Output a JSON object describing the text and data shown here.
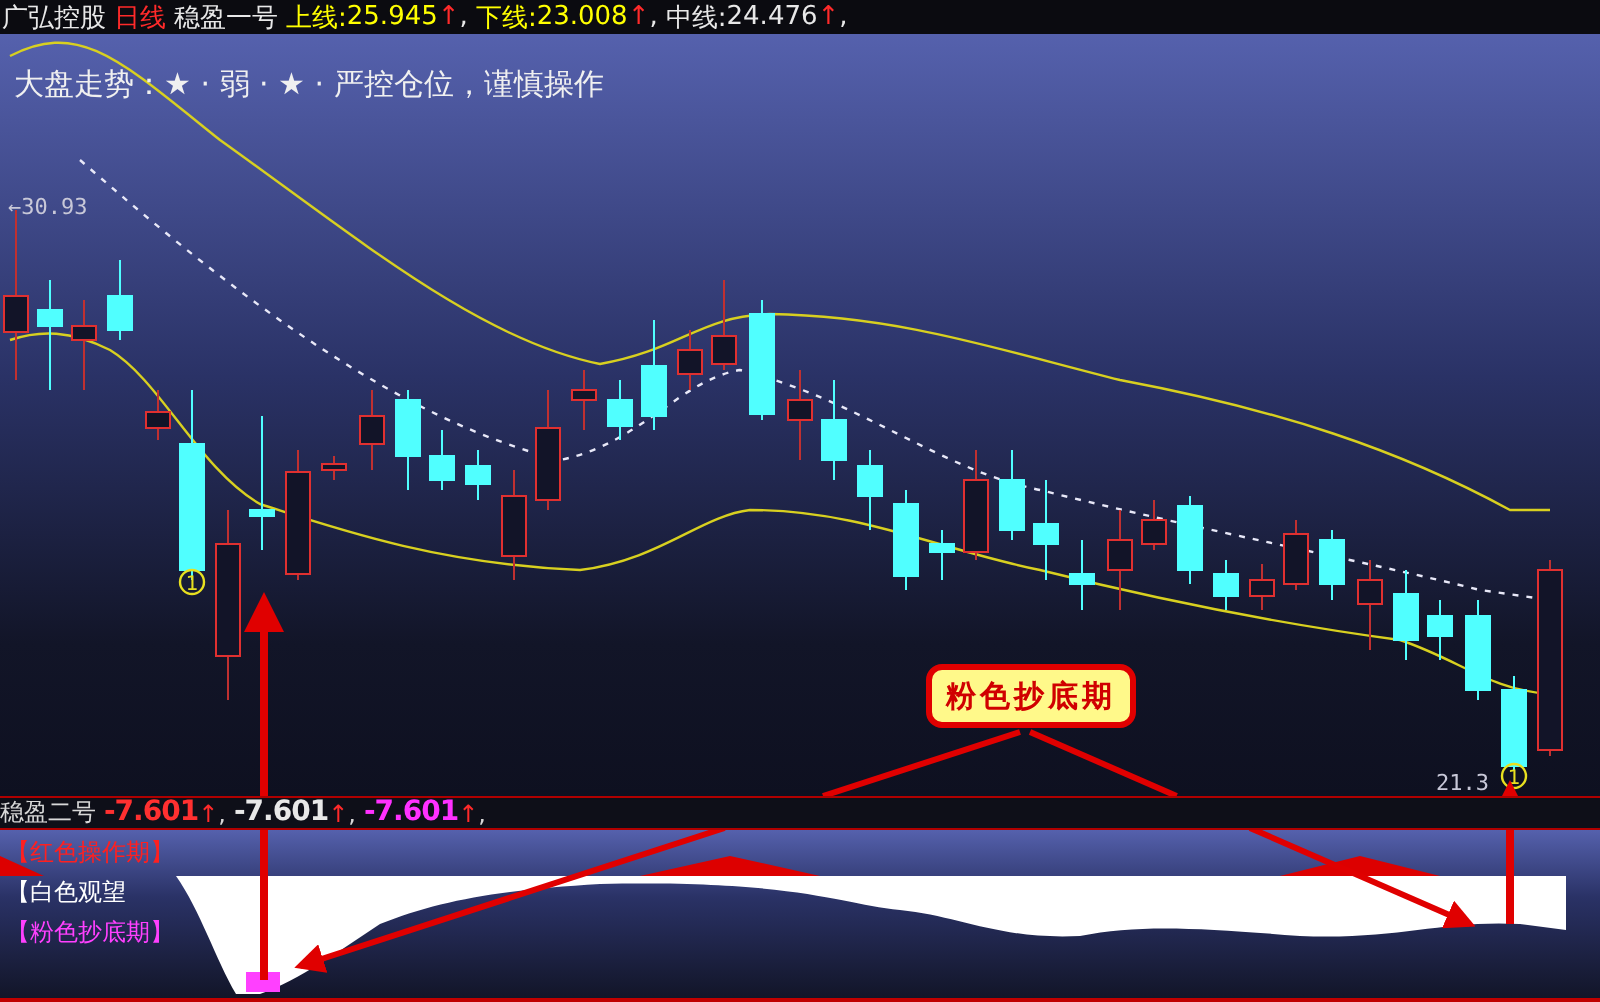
{
  "header": {
    "stock": "广弘控股",
    "period": "日线",
    "indicator": "稳盈一号",
    "lines": [
      {
        "label": "上线:",
        "value": "25.945",
        "arrow": "↑",
        "separator": ",",
        "color": "#ffff00"
      },
      {
        "label": "下线:",
        "value": "23.008",
        "arrow": "↑",
        "separator": ",",
        "color": "#ffff00"
      },
      {
        "label": "中线:",
        "value": "24.476",
        "arrow": "↑",
        "separator": ",",
        "color": "#e8e8e8"
      }
    ]
  },
  "main_chart": {
    "notice": "大盘走势：★ · 弱 · ★ · 严控仓位，谨慎操作",
    "high_label": "←30.93",
    "low_label": "21.3",
    "signal_markers": [
      {
        "label": "1"
      },
      {
        "label": "1"
      }
    ],
    "callout": "粉色抄底期"
  },
  "indicator_bar": {
    "title": "稳盈二号",
    "values": [
      {
        "value": "-7.601",
        "arrow": "↑",
        "separator": ",",
        "color": "#ff3030"
      },
      {
        "value": "-7.601",
        "arrow": "↑",
        "separator": ",",
        "color": "#e8e8e8"
      },
      {
        "value": "-7.601",
        "arrow": "↑",
        "separator": ",",
        "color": "#ff30ff"
      }
    ]
  },
  "lower_panel": {
    "legend": [
      {
        "label": "【红色操作期】",
        "color": "#ff2020"
      },
      {
        "label": "【白色观望",
        "color": "#ffffff"
      },
      {
        "label": "【粉色抄底期】",
        "color": "#ff40ff"
      }
    ]
  }
}
